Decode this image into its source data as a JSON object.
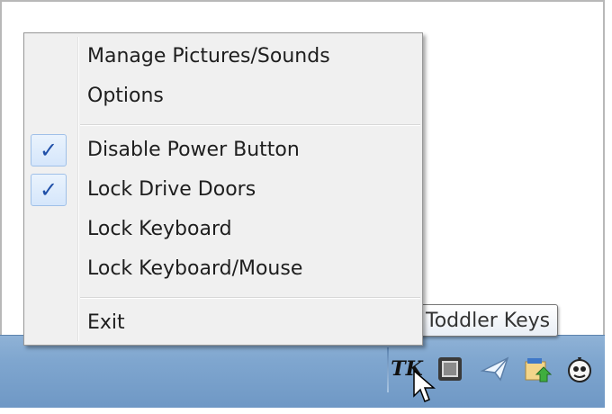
{
  "menu": {
    "items": [
      {
        "label": "Manage Pictures/Sounds",
        "checked": false
      },
      {
        "label": "Options",
        "checked": false
      },
      {
        "label": "Disable Power Button",
        "checked": true
      },
      {
        "label": "Lock Drive Doors",
        "checked": true
      },
      {
        "label": "Lock Keyboard",
        "checked": false
      },
      {
        "label": "Lock Keyboard/Mouse",
        "checked": false
      },
      {
        "label": "Exit",
        "checked": false
      }
    ],
    "check_glyph": "✓"
  },
  "tooltip": {
    "text": "Toddler Keys"
  },
  "tray": {
    "app_icon_text": "TK",
    "icons": [
      "toddler-keys-icon",
      "app-window-icon",
      "paper-plane-icon",
      "network-share-icon",
      "cartoon-character-icon"
    ]
  },
  "colors": {
    "taskbar": "#7fa6cf",
    "check_accent": "#1f4fa8",
    "menu_bg": "#f0f0f0"
  }
}
